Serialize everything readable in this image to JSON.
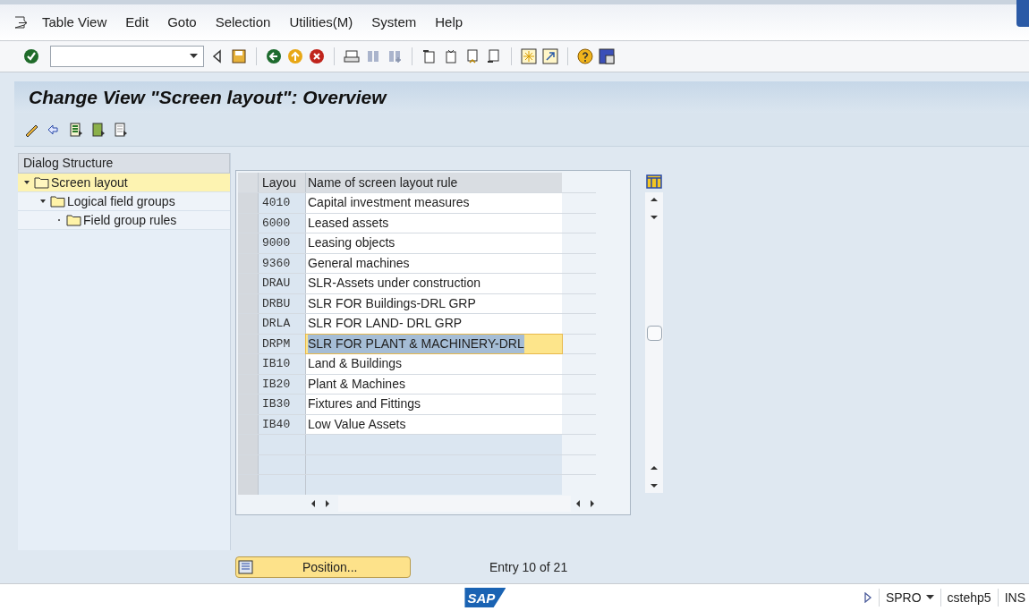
{
  "menu": [
    "Table View",
    "Edit",
    "Goto",
    "Selection",
    "Utilities(M)",
    "System",
    "Help"
  ],
  "title": "Change View \"Screen layout\": Overview",
  "dialog_structure": {
    "title": "Dialog Structure",
    "tree": [
      {
        "label": "Screen layout",
        "selected": true,
        "expanded": true,
        "children": [
          {
            "label": "Logical field groups",
            "selected": false,
            "expanded": true,
            "children": [
              {
                "label": "Field group rules",
                "selected": false
              }
            ]
          }
        ]
      }
    ]
  },
  "table": {
    "columns": [
      "Layou",
      "Name of screen layout rule"
    ],
    "rows": [
      {
        "key": "4010",
        "name": "Capital investment measures",
        "selected": false
      },
      {
        "key": "6000",
        "name": "Leased assets",
        "selected": false
      },
      {
        "key": "9000",
        "name": "Leasing objects",
        "selected": false
      },
      {
        "key": "9360",
        "name": "General machines",
        "selected": false
      },
      {
        "key": "DRAU",
        "name": "SLR-Assets under construction",
        "selected": false
      },
      {
        "key": "DRBU",
        "name": "SLR FOR Buildings-DRL GRP",
        "selected": false
      },
      {
        "key": "DRLA",
        "name": "SLR FOR LAND- DRL GRP",
        "selected": false
      },
      {
        "key": "DRPM",
        "name": "SLR FOR PLANT & MACHINERY-DRL",
        "selected": true
      },
      {
        "key": "IB10",
        "name": "Land & Buildings",
        "selected": false
      },
      {
        "key": "IB20",
        "name": "Plant & Machines",
        "selected": false
      },
      {
        "key": "IB30",
        "name": "Fixtures and Fittings",
        "selected": false
      },
      {
        "key": "IB40",
        "name": "Low Value Assets",
        "selected": false
      }
    ]
  },
  "position_button": "Position...",
  "entry_info": "Entry 10 of 21",
  "logo": "SAP",
  "status_bar": {
    "transaction": "SPRO",
    "server": "cstehp5",
    "mode": "INS"
  }
}
